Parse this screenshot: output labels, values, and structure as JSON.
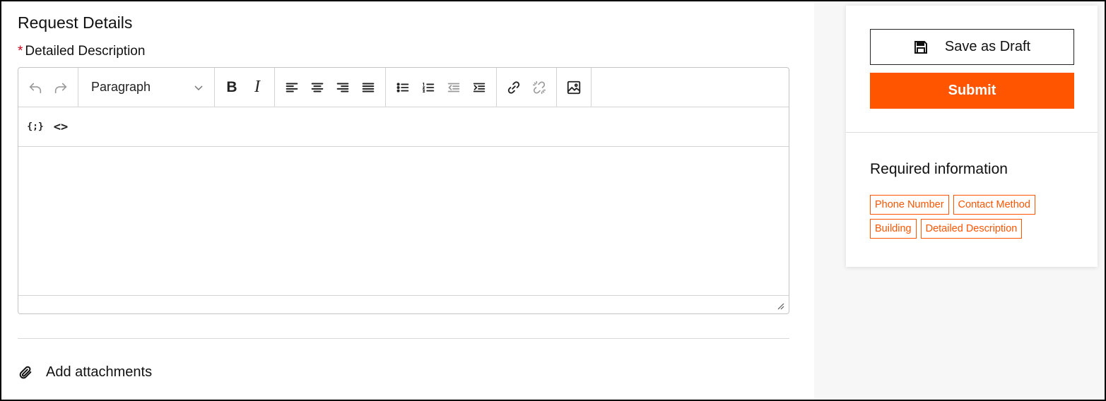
{
  "section": {
    "title": "Request Details"
  },
  "field": {
    "required_mark": "*",
    "label": "Detailed Description"
  },
  "toolbar": {
    "undo": "undo-icon",
    "redo": "redo-icon",
    "block_format": "Paragraph",
    "bold": "B",
    "italic": "I",
    "variables": "{;}",
    "source": "<>"
  },
  "attachments": {
    "label": "Add attachments"
  },
  "actions": {
    "save_draft": "Save as Draft",
    "submit": "Submit"
  },
  "required_info": {
    "title": "Required information",
    "items": [
      "Phone Number",
      "Contact Method",
      "Building",
      "Detailed Description"
    ]
  },
  "colors": {
    "accent": "#ff5500",
    "required": "#d0021b",
    "right_pane_bg": "#f7f7f7"
  }
}
